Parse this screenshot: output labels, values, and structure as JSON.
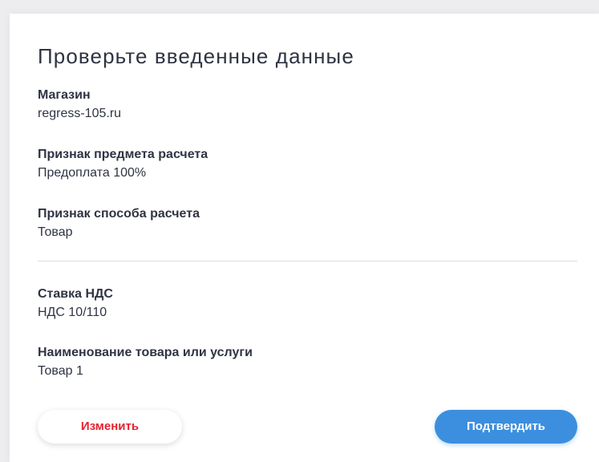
{
  "dialog": {
    "title": "Проверьте введенные данные",
    "fields": [
      {
        "label": "Магазин",
        "value": "regress-105.ru"
      },
      {
        "label": "Признак предмета расчета",
        "value": "Предоплата 100%"
      },
      {
        "label": "Признак способа расчета",
        "value": "Товар"
      },
      {
        "label": "Ставка НДС",
        "value": "НДС 10/110"
      },
      {
        "label": "Наименование товара или услуги",
        "value": "Товар 1"
      }
    ],
    "buttons": {
      "change_label": "Изменить",
      "confirm_label": "Подтвердить"
    }
  },
  "colors": {
    "accent": "#3b8fde",
    "danger": "#e5232f",
    "text": "#2f3443"
  }
}
